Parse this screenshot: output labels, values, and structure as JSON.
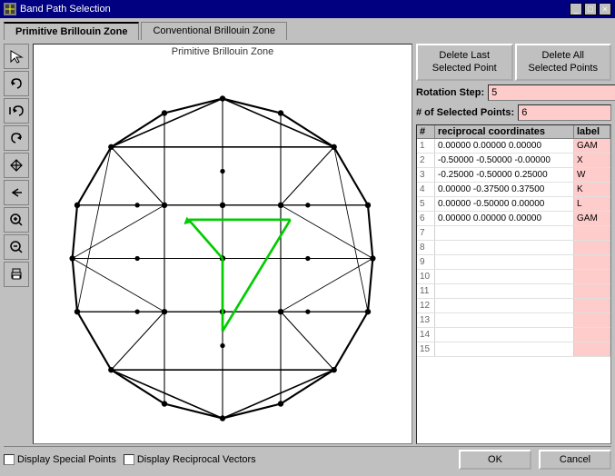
{
  "titleBar": {
    "icon": "band-path-icon",
    "title": "Band Path Selection",
    "minButton": "_",
    "maxButton": "□",
    "closeButton": "×"
  },
  "tabs": [
    {
      "id": "primitive",
      "label": "Primitive Brillouin Zone",
      "active": true
    },
    {
      "id": "conventional",
      "label": "Conventional Brillouin Zone",
      "active": false
    }
  ],
  "canvas": {
    "label": "Primitive Brillouin Zone"
  },
  "toolbar": {
    "buttons": [
      {
        "id": "cursor",
        "icon": "↖",
        "title": "Select"
      },
      {
        "id": "undo1",
        "icon": "↩",
        "title": "Undo"
      },
      {
        "id": "undo2",
        "icon": "↺",
        "title": "Undo All"
      },
      {
        "id": "redo",
        "icon": "↻",
        "title": "Redo"
      },
      {
        "id": "hand",
        "icon": "☛",
        "title": "Pan"
      },
      {
        "id": "back",
        "icon": "↩",
        "title": "Back"
      },
      {
        "id": "zoomin",
        "icon": "+",
        "title": "Zoom In"
      },
      {
        "id": "zoomout",
        "icon": "−",
        "title": "Zoom Out"
      },
      {
        "id": "print",
        "icon": "🖨",
        "title": "Print"
      }
    ]
  },
  "rightPanel": {
    "deleteLastLabel": "Delete Last\nSelected Point",
    "deleteAllLabel": "Delete All\nSelected Points",
    "rotationStepLabel": "Rotation Step:",
    "rotationStepValue": "5",
    "numSelectedLabel": "# of Selected Points:",
    "numSelectedValue": "6",
    "tableHeaders": {
      "num": "#",
      "coords": "reciprocal coordinates",
      "label": "label"
    },
    "tableRows": [
      {
        "num": "1",
        "coords": "0.00000  0.00000  0.00000",
        "label": "GAM"
      },
      {
        "num": "2",
        "coords": "-0.50000 -0.50000 -0.00000",
        "label": "X"
      },
      {
        "num": "3",
        "coords": "-0.25000 -0.50000  0.25000",
        "label": "W"
      },
      {
        "num": "4",
        "coords": "0.00000 -0.37500  0.37500",
        "label": "K"
      },
      {
        "num": "5",
        "coords": "0.00000 -0.50000  0.00000",
        "label": "L"
      },
      {
        "num": "6",
        "coords": "0.00000  0.00000  0.00000",
        "label": "GAM"
      },
      {
        "num": "7",
        "coords": "",
        "label": ""
      },
      {
        "num": "8",
        "coords": "",
        "label": ""
      },
      {
        "num": "9",
        "coords": "",
        "label": ""
      },
      {
        "num": "10",
        "coords": "",
        "label": ""
      },
      {
        "num": "11",
        "coords": "",
        "label": ""
      },
      {
        "num": "12",
        "coords": "",
        "label": ""
      },
      {
        "num": "13",
        "coords": "",
        "label": ""
      },
      {
        "num": "14",
        "coords": "",
        "label": ""
      },
      {
        "num": "15",
        "coords": "",
        "label": ""
      }
    ]
  },
  "bottomBar": {
    "checkboxes": [
      {
        "id": "displaySpecial",
        "label": "Display Special Points",
        "checked": false
      },
      {
        "id": "displayReciprocal",
        "label": "Display Reciprocal Vectors",
        "checked": false
      }
    ]
  },
  "buttons": {
    "ok": "OK",
    "cancel": "Cancel"
  }
}
